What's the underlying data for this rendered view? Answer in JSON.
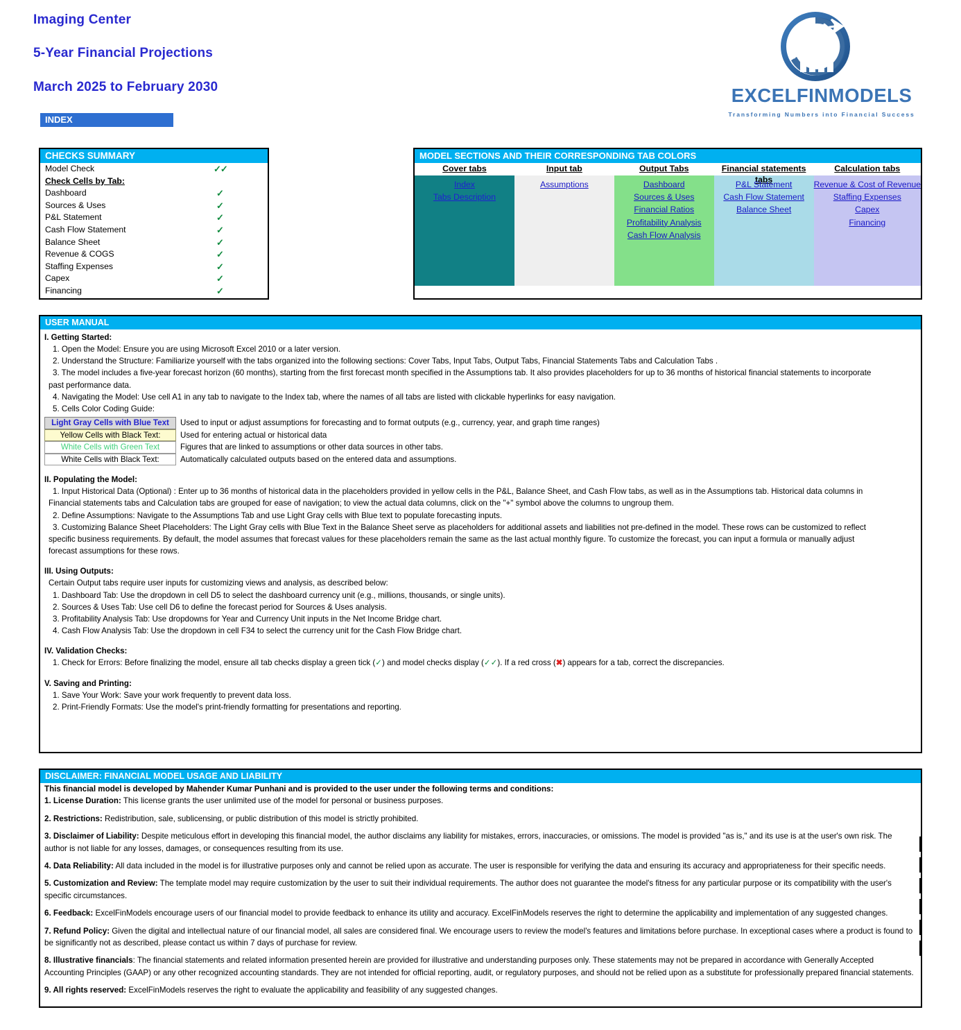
{
  "header": {
    "company": "Imaging Center",
    "subtitle": "5-Year Financial Projections",
    "period": "March 2025 to February 2030",
    "index_tag": "INDEX",
    "logo_wordmark": "EXCELFINMODELS",
    "logo_tagline": "Transforming Numbers into Financial Success",
    "brand_color": "#3b74b5",
    "title_color": "#2929cf",
    "accent_color": "#00b0f0"
  },
  "checks_summary": {
    "title": "CHECKS  SUMMARY",
    "model_check": {
      "label": "Model Check",
      "mark": "✓✓"
    },
    "subhead": "Check Cells by Tab:",
    "rows": [
      {
        "label": "Dashboard",
        "mark": "✓"
      },
      {
        "label": "Sources & Uses",
        "mark": "✓"
      },
      {
        "label": "P&L Statement",
        "mark": "✓"
      },
      {
        "label": "Cash Flow Statement",
        "mark": "✓"
      },
      {
        "label": "Balance Sheet",
        "mark": "✓"
      },
      {
        "label": "Revenue & COGS",
        "mark": "✓"
      },
      {
        "label": "Staffing Expenses",
        "mark": "✓"
      },
      {
        "label": "Capex",
        "mark": "✓"
      },
      {
        "label": "Financing",
        "mark": "✓"
      }
    ]
  },
  "model_sections": {
    "title": "MODEL SECTIONS AND THEIR CORRESPONDING TAB COLORS",
    "columns": [
      {
        "title": "Cover tabs",
        "color": "#118085",
        "links": [
          "Index",
          "Tabs Description"
        ]
      },
      {
        "title": "Input tab",
        "color": "#efefef",
        "links": [
          "Assumptions "
        ]
      },
      {
        "title": "Output Tabs",
        "color": "#84e08a",
        "links": [
          "Dashboard",
          "Sources & Uses",
          "Financial Ratios ",
          "Profitability Analysis",
          "Cash Flow Analysis"
        ]
      },
      {
        "title": "Financial statements tabs",
        "color": "#aadbe8",
        "links": [
          "P&L Statement",
          "Cash Flow Statement",
          "Balance Sheet"
        ]
      },
      {
        "title": "Calculation tabs",
        "color": "#c5c5f2",
        "links": [
          "Revenue & Cost of Revenue",
          "Staffing Expenses",
          "Capex ",
          "Financing"
        ]
      }
    ]
  },
  "user_manual": {
    "title": "USER MANUAL",
    "s1_head": "I. Getting Started:",
    "s1_items": [
      "1. Open the Model: Ensure you are using Microsoft Excel 2010 or a later version.",
      "2. Understand the Structure: Familiarize yourself with the tabs organized into the following sections: Cover Tabs, Input Tabs, Output Tabs, Financial Statements Tabs and Calculation Tabs  .",
      "3. The model includes a five-year forecast horizon (60 months), starting from the first forecast month specified in the Assumptions tab. It also provides placeholders for up to 36 months of historical financial statements to incorporate",
      "past performance data.",
      "4. Navigating the Model: Use cell A1 in any tab to navigate to the Index tab, where the names of all tabs are listed with clickable hyperlinks for easy navigation.",
      "5. Cells Color Coding Guide:"
    ],
    "color_guide": [
      {
        "key": "Light Gray Cells with Blue Text",
        "desc": "Used to input or adjust assumptions for forecasting and to format outputs (e.g., currency, year, and graph time ranges)"
      },
      {
        "key": "Yellow Cells with Black Text:",
        "desc": "Used for entering actual or historical data"
      },
      {
        "key": "White Cells with Green Text",
        "desc": "Figures that are linked to assumptions or other data sources in other tabs."
      },
      {
        "key": "White Cells with Black Text:",
        "desc": "Automatically calculated outputs based on the entered data and assumptions."
      }
    ],
    "s2_head": "II. Populating the Model:",
    "s2_items": [
      "1. Input Historical Data (Optional) : Enter up to 36 months of historical data in the placeholders provided in yellow cells in the P&L, Balance Sheet, and Cash Flow tabs, as well as in the Assumptions tab. Historical data columns in",
      "Financial statements tabs and Calculation tabs are grouped for ease of navigation; to view the actual data columns, click on the \"+\" symbol above the columns to ungroup them.",
      "2. Define Assumptions: Navigate to the Assumptions Tab and use Light Gray cells with Blue text to populate forecasting inputs.",
      "3. Customizing Balance Sheet Placeholders: The Light Gray cells with Blue Text in the Balance Sheet serve as placeholders for additional assets and liabilities not pre-defined in the model. These rows can be customized to reflect",
      "specific business requirements. By default, the model assumes that forecast values for these placeholders remain the same as the last actual monthly figure. To customize the forecast, you can input a formula or manually adjust",
      "forecast assumptions for these rows."
    ],
    "s3_head": "III. Using Outputs:",
    "s3_intro": "Certain Output tabs require user inputs for customizing views and analysis, as described below:",
    "s3_items": [
      "1. Dashboard Tab: Use the dropdown in cell D5 to select the dashboard currency unit (e.g., millions, thousands, or single units).",
      "2. Sources & Uses Tab: Use cell D6 to define the forecast period for Sources & Uses analysis.",
      "3. Profitability Analysis Tab: Use dropdowns for Year and Currency Unit inputs in the Net Income Bridge chart.",
      "4. Cash Flow Analysis Tab: Use the dropdown in cell F34 to select the currency unit for the Cash Flow Bridge chart."
    ],
    "s4_head": "IV. Validation Checks:",
    "s4_item_a": "1. Check for Errors:  Before finalizing the model, ensure all tab checks display a green tick (",
    "s4_tick1": "✓",
    "s4_item_b": ") and model checks display  (",
    "s4_tick2": "✓✓",
    "s4_item_c": "). If a red cross (",
    "s4_cross": "✖",
    "s4_item_d": ") appears for a tab, correct the discrepancies.",
    "s5_head": "V. Saving and Printing:",
    "s5_items": [
      "1. Save Your Work: Save your work frequently to prevent data loss.",
      "2. Print-Friendly Formats: Use the model's print-friendly formatting for presentations and reporting."
    ]
  },
  "disclaimer": {
    "title": "DISCLAIMER: FINANCIAL MODEL USAGE AND LIABILITY",
    "lead": "This financial model  is developed by Mahender Kumar Punhani and is provided to the user under the following terms and conditions:",
    "items": [
      {
        "num": "1. ",
        "label": "License Duration:",
        "text": " This license grants the user unlimited use of the model for personal or business purposes."
      },
      {
        "num": "2. ",
        "label": "Restrictions:",
        "text": " Redistribution, sale, sublicensing, or public distribution of this model is strictly prohibited."
      },
      {
        "num": "3. ",
        "label": "Disclaimer of Liability:",
        "text": " Despite meticulous effort in developing this financial model, the author disclaims any liability for mistakes, errors, inaccuracies, or omissions. The model is provided \"as is,\" and its use is at the user's own risk. The author is not liable for  any losses, damages, or consequences resulting from its use."
      },
      {
        "num": "4. ",
        "label": "Data Reliability:",
        "text": " All data included in the model is for illustrative purposes only and cannot be relied upon as accurate. The user is  responsible for verifying the data and ensuring its accuracy and appropriateness for their specific needs."
      },
      {
        "num": "5. ",
        "label": "Customization and Review:",
        "text": " The template model may require customization by the user to suit their individual requirements. The author does not guarantee the model's fitness for any  particular purpose or its compatibility with the user's specific circumstances."
      },
      {
        "num": "6. ",
        "label": "Feedback:",
        "text": " ExcelFinModels encourage users of our financial model to provide feedback to enhance its utility and accuracy. ExcelFinModels reserves the right to determine the applicability and implementation of any suggested changes."
      },
      {
        "num": "7. ",
        "label": "Refund Policy:",
        "text": " Given the digital and intellectual nature of our financial model, all sales are considered final. We encourage users to review the model's features and limitations before purchase. In exceptional cases where a product is found to be  significantly not as described, please contact us within 7 days of purchase for review."
      },
      {
        "num": "8. ",
        "label": "Illustrative financials",
        "text": ": The financial statements and related information presented herein are provided for illustrative and understanding purposes only. These statements may not be prepared in accordance with Generally Accepted Accounting Principles (GAAP)  or any other  recognized accounting standards. They are not intended for official reporting, audit, or regulatory purposes, and should not be relied upon as a substitute for professionally prepared financial statements."
      },
      {
        "num": "9. ",
        "label": "All rights reserved:",
        "text": " ExcelFinModels reserves the right to evaluate the applicability and feasibility of any suggested changes."
      }
    ]
  }
}
